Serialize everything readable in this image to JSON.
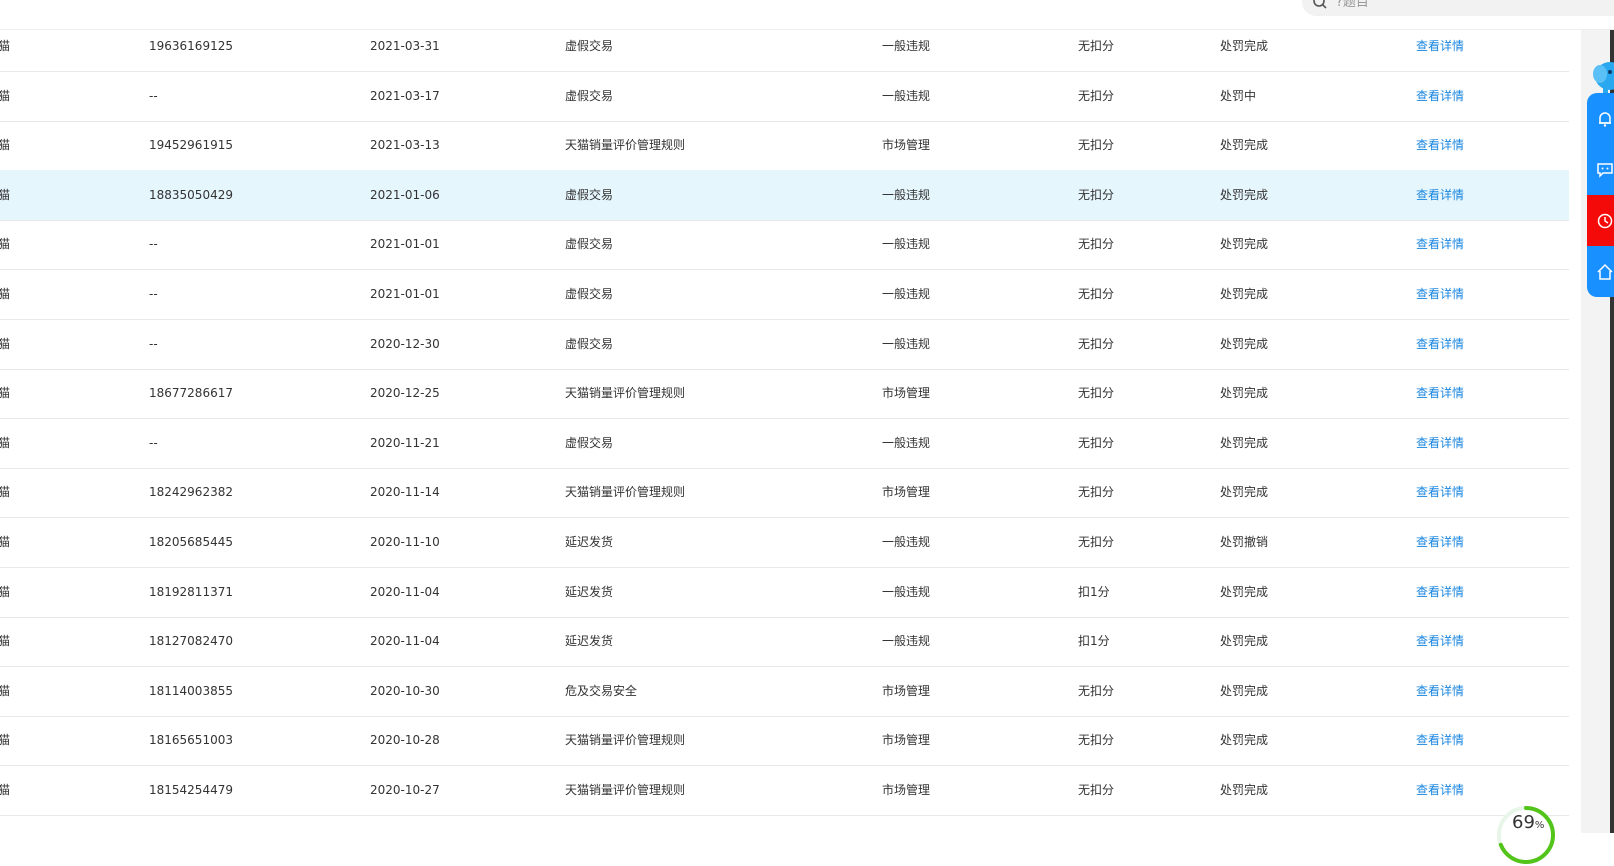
{
  "search": {
    "placeholder": "?题目"
  },
  "columns": 8,
  "rows": [
    {
      "c0": "猫",
      "id": "19636169125",
      "date": "2021-03-31",
      "reason": "虚假交易",
      "type": "一般违规",
      "score": "无扣分",
      "status": "处罚完成",
      "action": "查看详情"
    },
    {
      "c0": "猫",
      "id": "--",
      "date": "2021-03-17",
      "reason": "虚假交易",
      "type": "一般违规",
      "score": "无扣分",
      "status": "处罚中",
      "action": "查看详情"
    },
    {
      "c0": "猫",
      "id": "19452961915",
      "date": "2021-03-13",
      "reason": "天猫销量评价管理规则",
      "type": "市场管理",
      "score": "无扣分",
      "status": "处罚完成",
      "action": "查看详情"
    },
    {
      "c0": "猫",
      "id": "18835050429",
      "date": "2021-01-06",
      "reason": "虚假交易",
      "type": "一般违规",
      "score": "无扣分",
      "status": "处罚完成",
      "action": "查看详情",
      "highlight": true
    },
    {
      "c0": "猫",
      "id": "--",
      "date": "2021-01-01",
      "reason": "虚假交易",
      "type": "一般违规",
      "score": "无扣分",
      "status": "处罚完成",
      "action": "查看详情"
    },
    {
      "c0": "猫",
      "id": "--",
      "date": "2021-01-01",
      "reason": "虚假交易",
      "type": "一般违规",
      "score": "无扣分",
      "status": "处罚完成",
      "action": "查看详情"
    },
    {
      "c0": "猫",
      "id": "--",
      "date": "2020-12-30",
      "reason": "虚假交易",
      "type": "一般违规",
      "score": "无扣分",
      "status": "处罚完成",
      "action": "查看详情"
    },
    {
      "c0": "猫",
      "id": "18677286617",
      "date": "2020-12-25",
      "reason": "天猫销量评价管理规则",
      "type": "市场管理",
      "score": "无扣分",
      "status": "处罚完成",
      "action": "查看详情"
    },
    {
      "c0": "猫",
      "id": "--",
      "date": "2020-11-21",
      "reason": "虚假交易",
      "type": "一般违规",
      "score": "无扣分",
      "status": "处罚完成",
      "action": "查看详情"
    },
    {
      "c0": "猫",
      "id": "18242962382",
      "date": "2020-11-14",
      "reason": "天猫销量评价管理规则",
      "type": "市场管理",
      "score": "无扣分",
      "status": "处罚完成",
      "action": "查看详情"
    },
    {
      "c0": "猫",
      "id": "18205685445",
      "date": "2020-11-10",
      "reason": "延迟发货",
      "type": "一般违规",
      "score": "无扣分",
      "status": "处罚撤销",
      "action": "查看详情"
    },
    {
      "c0": "猫",
      "id": "18192811371",
      "date": "2020-11-04",
      "reason": "延迟发货",
      "type": "一般违规",
      "score": "扣1分",
      "status": "处罚完成",
      "action": "查看详情"
    },
    {
      "c0": "猫",
      "id": "18127082470",
      "date": "2020-11-04",
      "reason": "延迟发货",
      "type": "一般违规",
      "score": "扣1分",
      "status": "处罚完成",
      "action": "查看详情"
    },
    {
      "c0": "猫",
      "id": "18114003855",
      "date": "2020-10-30",
      "reason": "危及交易安全",
      "type": "市场管理",
      "score": "无扣分",
      "status": "处罚完成",
      "action": "查看详情"
    },
    {
      "c0": "猫",
      "id": "18165651003",
      "date": "2020-10-28",
      "reason": "天猫销量评价管理规则",
      "type": "市场管理",
      "score": "无扣分",
      "status": "处罚完成",
      "action": "查看详情"
    },
    {
      "c0": "猫",
      "id": "18154254479",
      "date": "2020-10-27",
      "reason": "天猫销量评价管理规则",
      "type": "市场管理",
      "score": "无扣分",
      "status": "处罚完成",
      "action": "查看详情"
    }
  ],
  "side_toolbar": [
    {
      "icon": "bell-icon",
      "color": "#1890ff"
    },
    {
      "icon": "chat-icon",
      "color": "#1890ff"
    },
    {
      "icon": "alarm-icon",
      "color": "#f50a0a"
    },
    {
      "icon": "home-icon",
      "color": "#1890ff"
    }
  ],
  "progress": {
    "value": 69,
    "unit": "%"
  }
}
